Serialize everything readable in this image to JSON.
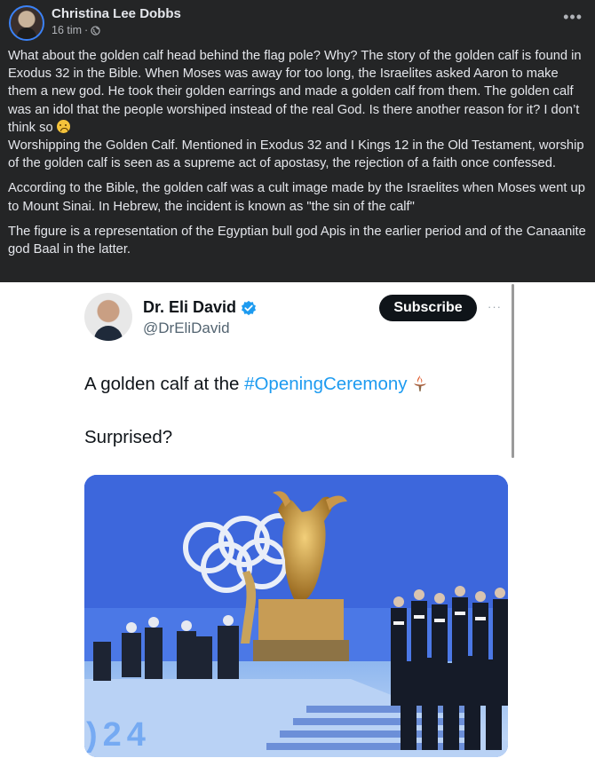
{
  "post": {
    "author_name": "Christina Lee Dobbs",
    "timestamp": "16 tim",
    "separator": "·",
    "audience_icon": "globe-icon",
    "more_icon": "more-horizontal-icon",
    "paragraphs": [
      "What about the golden calf head behind the flag pole?  Why?  The story of the golden calf is found in Exodus 32 in the Bible. When Moses was away for too long, the Israelites asked Aaron to make them a new god. He took their golden earrings and made a golden calf from them. The golden calf was an idol that the people worshiped instead of the real God.  Is there another reason for it?  I don’t think so",
      "Worshipping the Golden Calf. Mentioned in Exodus 32 and I Kings 12 in the Old Testament, worship of the golden calf is seen as a supreme act of apostasy, the rejection of a faith once confessed.",
      "According to the Bible, the golden calf was a cult image made by the Israelites when Moses went up to Mount Sinai. In Hebrew, the incident is known as \"the sin of the calf\"",
      "The figure is a representation of the Egyptian bull god Apis in the earlier period and of the Canaanite god Baal in the latter."
    ],
    "emoji_icon": "sad-face-emoji-icon"
  },
  "tweet": {
    "display_name": "Dr. Eli David",
    "handle": "@DrEliDavid",
    "verified_icon": "verified-badge-icon",
    "subscribe_label": "Subscribe",
    "more_label": "···",
    "text_prefix": "A golden calf at the ",
    "hashtag": "#OpeningCeremony",
    "torch_icon": "olympic-torch-icon",
    "text_line2": "Surprised?",
    "photo_year_text": "24",
    "photo_year_prefix": ")"
  },
  "colors": {
    "fb_background": "#242526",
    "fb_text": "#e4e6eb",
    "fb_secondary": "#b0b3b8",
    "tweet_hashtag": "#1d9bf0",
    "subscribe_bg": "#0f1419",
    "handle": "#536471"
  }
}
